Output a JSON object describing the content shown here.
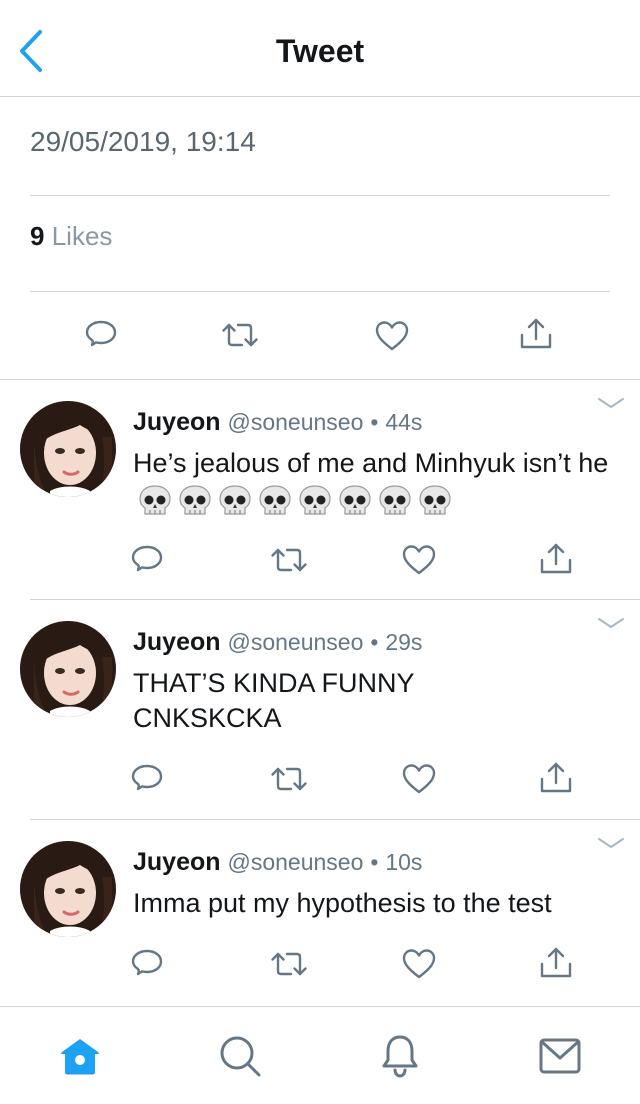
{
  "nav": {
    "title": "Tweet",
    "back_icon": "chevron-left-icon"
  },
  "tweet": {
    "timestamp": "29/05/2019, 19:14",
    "likes_count": "9",
    "likes_label": "Likes"
  },
  "colors": {
    "accent": "#1da1f2",
    "icon_gray": "#657786",
    "text": "#14171a",
    "divider": "#cfd6db"
  },
  "replies": [
    {
      "name": "Juyeon",
      "handle": "@soneunseo",
      "separator": "•",
      "age": "44s",
      "text": "He’s jealous of me and Minhyuk isn’t he",
      "emoji": "💀💀💀💀💀💀💀💀"
    },
    {
      "name": "Juyeon",
      "handle": "@soneunseo",
      "separator": "•",
      "age": "29s",
      "text": "THAT’S KINDA FUNNY CNKSKCKA"
    },
    {
      "name": "Juyeon",
      "handle": "@soneunseo",
      "separator": "•",
      "age": "10s",
      "text": "Imma put my hypothesis to the test"
    }
  ],
  "tabbar": {
    "items": [
      "home-icon",
      "search-icon",
      "bell-icon",
      "mail-icon"
    ],
    "active": "home-icon"
  }
}
